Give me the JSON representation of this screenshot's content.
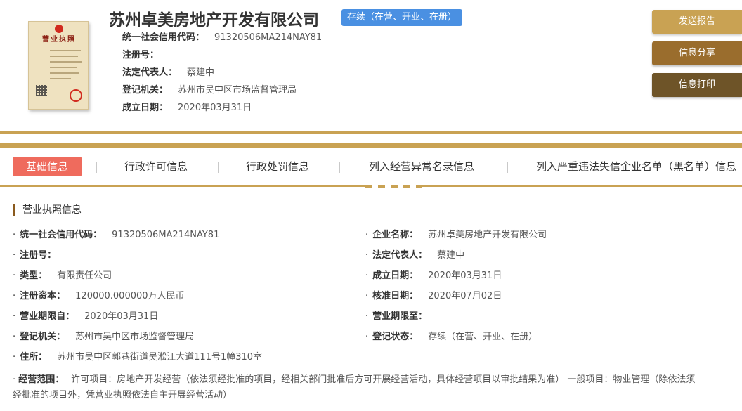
{
  "header": {
    "company_name": "苏州卓美房地产开发有限公司",
    "status_badge": "存续（在营、开业、在册）",
    "license_image_title": "营业执照",
    "rows": [
      {
        "label": "统一社会信用代码：",
        "value": "91320506MA214NAY81"
      },
      {
        "label": "注册号：",
        "value": ""
      },
      {
        "label": "法定代表人：",
        "value": "蔡建中"
      },
      {
        "label": "登记机关：",
        "value": "苏州市吴中区市场监督管理局"
      },
      {
        "label": "成立日期：",
        "value": "2020年03月31日"
      }
    ]
  },
  "actions": {
    "report": "发送报告",
    "share": "信息分享",
    "print": "信息打印"
  },
  "tabs": [
    {
      "label": "基础信息",
      "active": true
    },
    {
      "label": "行政许可信息",
      "active": false
    },
    {
      "label": "行政处罚信息",
      "active": false
    },
    {
      "label": "列入经营异常名录信息",
      "active": false
    },
    {
      "label": "列入严重违法失信企业名单（黑名单）信息",
      "active": false
    }
  ],
  "section": {
    "title": "营业执照信息",
    "bullet": "·",
    "fields_left": [
      {
        "label": "统一社会信用代码：",
        "value": "91320506MA214NAY81"
      },
      {
        "label": "注册号：",
        "value": ""
      },
      {
        "label": "类型：",
        "value": "有限责任公司"
      },
      {
        "label": "注册资本：",
        "value": "120000.000000万人民币"
      },
      {
        "label": "营业期限自：",
        "value": "2020年03月31日"
      },
      {
        "label": "登记机关：",
        "value": "苏州市吴中区市场监督管理局"
      },
      {
        "label": "住所：",
        "value": "苏州市吴中区郭巷街道吴淞江大道111号1幢310室"
      }
    ],
    "fields_right": [
      {
        "label": "企业名称：",
        "value": "苏州卓美房地产开发有限公司"
      },
      {
        "label": "法定代表人：",
        "value": "蔡建中"
      },
      {
        "label": "成立日期：",
        "value": "2020年03月31日"
      },
      {
        "label": "核准日期：",
        "value": "2020年07月02日"
      },
      {
        "label": "营业期限至：",
        "value": ""
      },
      {
        "label": "登记状态：",
        "value": "存续（在营、开业、在册）"
      }
    ],
    "scope": {
      "label": "经营范围：",
      "line1": "许可项目：房地产开发经营（依法须经批准的项目，经相关部门批准后方可开展经营活动，具体经营项目以审批结果为准） 一般项目：物业管理（除依法须",
      "line2": "经批准的项目外，凭营业执照依法自主开展经营活动）"
    }
  },
  "colors": {
    "gold": "#c9a253",
    "badge_blue": "#4a90e2",
    "active_tab": "#ef6b5d",
    "btn_report": "#c9a253",
    "btn_share": "#9a6d2d",
    "btn_print": "#6e5428"
  }
}
